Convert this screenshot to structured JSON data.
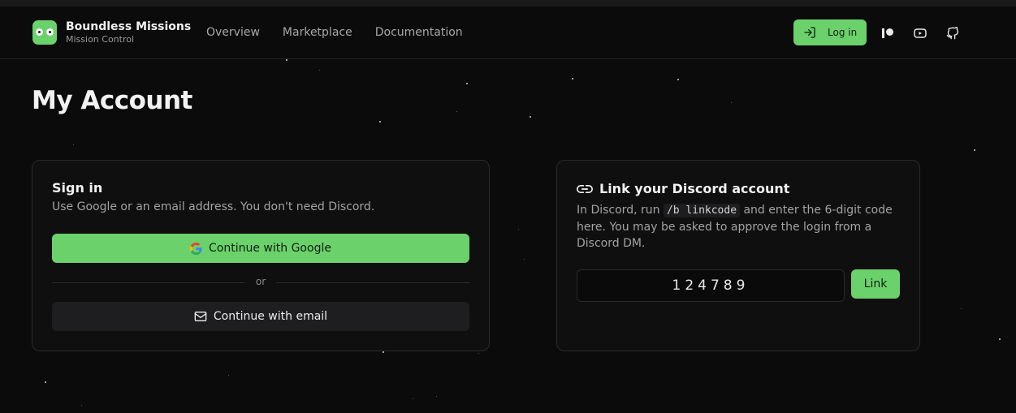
{
  "header": {
    "brand_title": "Boundless Missions",
    "brand_subtitle": "Mission Control",
    "nav": [
      "Overview",
      "Marketplace",
      "Documentation"
    ],
    "login_label": "Log in",
    "icons": [
      "patreon-icon",
      "youtube-icon",
      "github-icon"
    ]
  },
  "page": {
    "title": "My Account"
  },
  "signin": {
    "title": "Sign in",
    "description": "Use Google or an email address. You don't need Discord.",
    "google_label": "Continue with Google",
    "or_label": "or",
    "email_label": "Continue with email"
  },
  "discord": {
    "title": "Link your Discord account",
    "desc_before": "In Discord, run ",
    "command": "/b linkcode",
    "desc_after": " and enter the 6-digit code here. You may be asked to approve the login from a Discord DM.",
    "code_value": "124789",
    "link_label": "Link"
  },
  "colors": {
    "accent": "#6bd16b",
    "background": "#0b0b0c",
    "card": "#0f0f10"
  }
}
